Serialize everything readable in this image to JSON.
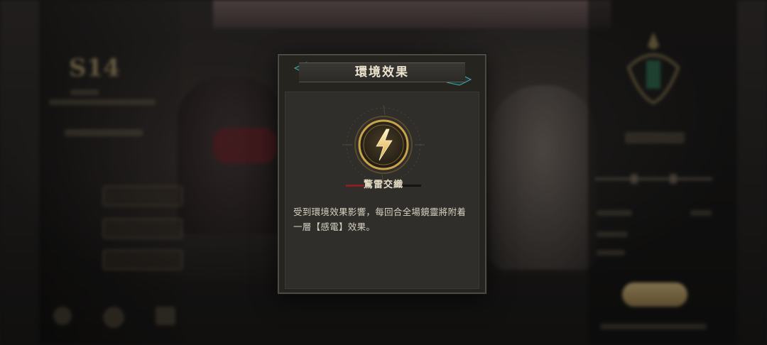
{
  "modal": {
    "title": "環境效果",
    "effect_name": "驚雷交織",
    "description": "受到環境效果影響，每回合全場鏡靈將附着一層【感電】效果。",
    "icon": "lightning-bolt-icon"
  },
  "background": {
    "left_panel": {
      "rank": "S14"
    }
  },
  "colors": {
    "modal_bg": "#26241f",
    "inner_bg": "#2f2e2b",
    "gold": "#c9a24a",
    "accent_red": "#8a1e22",
    "title_text": "#ece4cf"
  }
}
